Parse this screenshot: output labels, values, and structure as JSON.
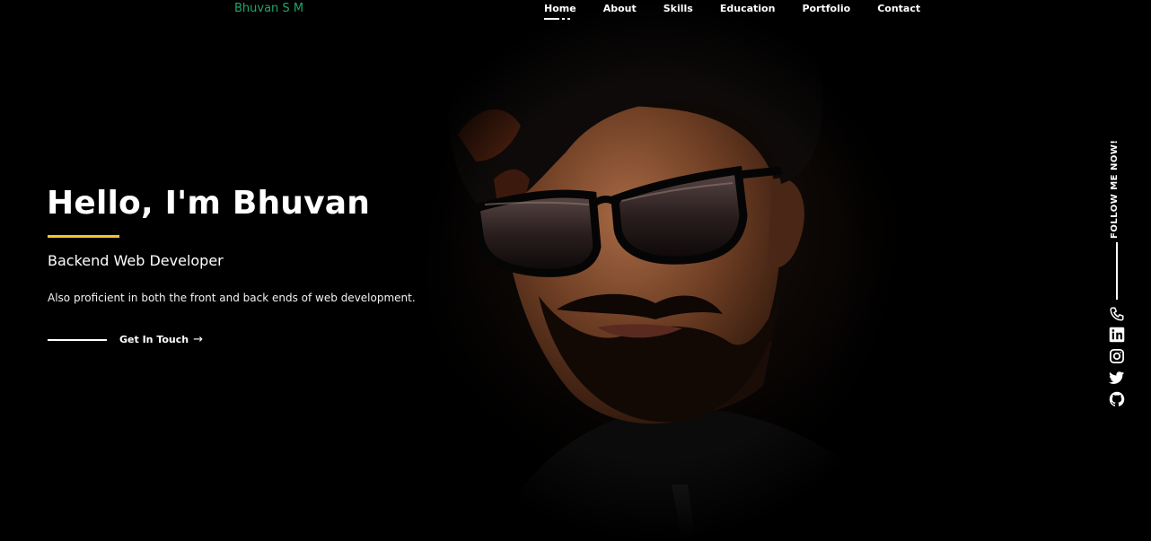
{
  "brand": {
    "name": "Bhuvan S M",
    "color": "#1fa66a"
  },
  "nav": {
    "items": [
      {
        "label": "Home",
        "active": true
      },
      {
        "label": "About",
        "active": false
      },
      {
        "label": "Skills",
        "active": false
      },
      {
        "label": "Education",
        "active": false
      },
      {
        "label": "Portfolio",
        "active": false
      },
      {
        "label": "Contact",
        "active": false
      }
    ]
  },
  "hero": {
    "title": "Hello, I'm Bhuvan",
    "role": "Backend Web Developer",
    "description": "Also proficient in both the front and back ends of web development.",
    "cta_label": "Get In Touch",
    "cta_arrow": "→",
    "accent_color": "#f4c430",
    "photo_icon": "profile-photo"
  },
  "social": {
    "heading": "FOLLOW ME NOW!",
    "links": [
      {
        "icon": "phone-icon"
      },
      {
        "icon": "linkedin-icon"
      },
      {
        "icon": "instagram-icon"
      },
      {
        "icon": "twitter-icon"
      },
      {
        "icon": "github-icon"
      }
    ]
  }
}
